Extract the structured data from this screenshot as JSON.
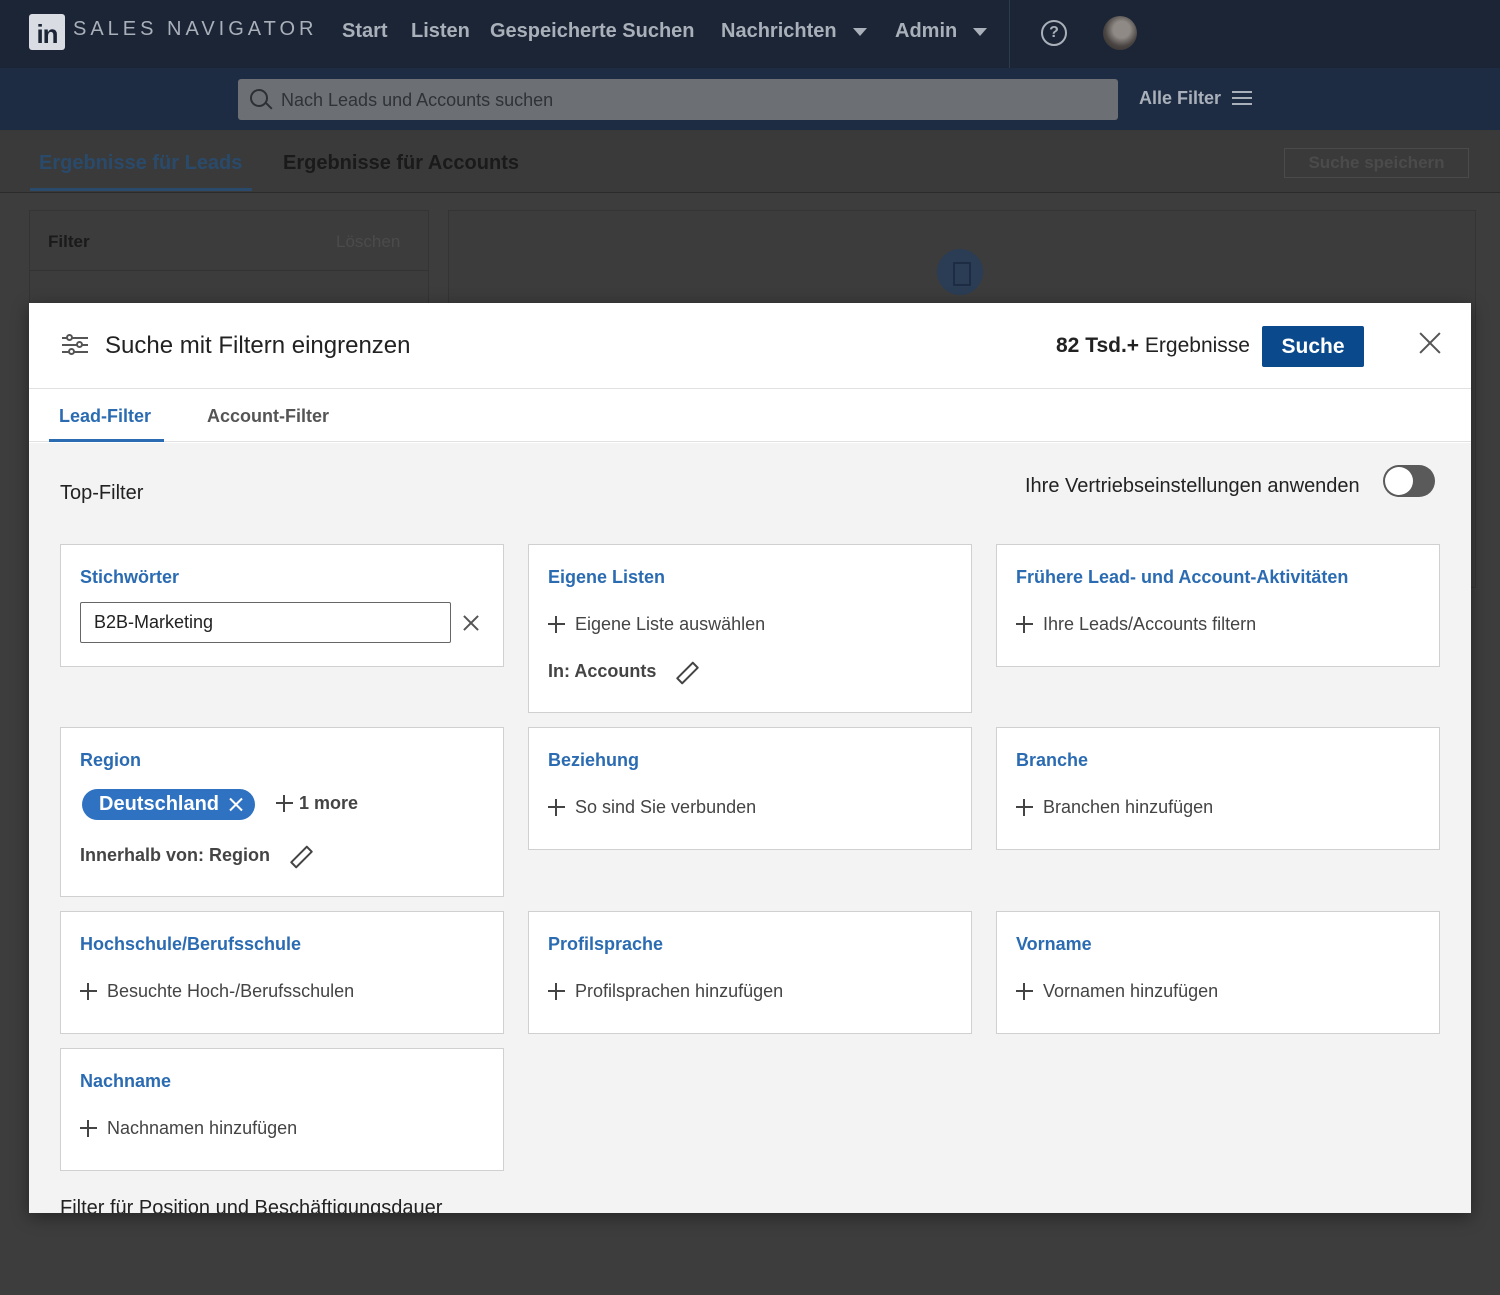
{
  "app": {
    "logo": "in",
    "brand": "SALES NAVIGATOR",
    "nav": [
      "Start",
      "Listen",
      "Gespeicherte Suchen",
      "Nachrichten",
      "Admin"
    ],
    "help_icon": "?"
  },
  "searchbar": {
    "placeholder": "Nach Leads und Accounts suchen",
    "all_filters_label": "Alle Filter"
  },
  "background_tabs": {
    "leads": "Ergebnisse für Leads",
    "accounts": "Ergebnisse für Accounts",
    "save_search": "Suche speichern"
  },
  "background_filter_panel": {
    "title": "Filter",
    "clear": "Löschen"
  },
  "modal": {
    "title": "Suche mit Filtern eingrenzen",
    "result_count_bold": "82 Tsd.+",
    "result_count_suffix": "Ergebnisse",
    "search_button": "Suche",
    "tabs": [
      "Lead-Filter",
      "Account-Filter"
    ],
    "active_tab": "Lead-Filter",
    "section_title": "Top-Filter",
    "toggle_label": "Ihre Vertriebseinstellungen anwenden",
    "toggle_on": false,
    "bottom_section_title": "Filter für Position und Beschäftigungsdauer"
  },
  "cards": {
    "keywords": {
      "title": "Stichwörter",
      "value": "B2B-Marketing"
    },
    "own_lists": {
      "title": "Eigene Listen",
      "add": "Eigene Liste auswählen",
      "meta": "In: Accounts"
    },
    "past_activity": {
      "title": "Frühere Lead- und Account-Aktivitäten",
      "add": "Ihre Leads/Accounts filtern"
    },
    "region": {
      "title": "Region",
      "pill": "Deutschland",
      "more": "1 more",
      "meta": "Innerhalb von: Region"
    },
    "relationship": {
      "title": "Beziehung",
      "add": "So sind Sie verbunden"
    },
    "industry": {
      "title": "Branche",
      "add": "Branchen hinzufügen"
    },
    "school": {
      "title": "Hochschule/Berufsschule",
      "add": "Besuchte Hoch-/Berufsschulen"
    },
    "profile_language": {
      "title": "Profilsprache",
      "add": "Profilsprachen hinzufügen"
    },
    "first_name": {
      "title": "Vorname",
      "add": "Vornamen hinzufügen"
    },
    "last_name": {
      "title": "Nachname",
      "add": "Nachnamen hinzufügen"
    }
  },
  "colors": {
    "accent_blue": "#2b6bb2",
    "button_blue": "#0a4a8c",
    "pill_blue": "#2e72c1",
    "topbar": "#1b2535"
  }
}
